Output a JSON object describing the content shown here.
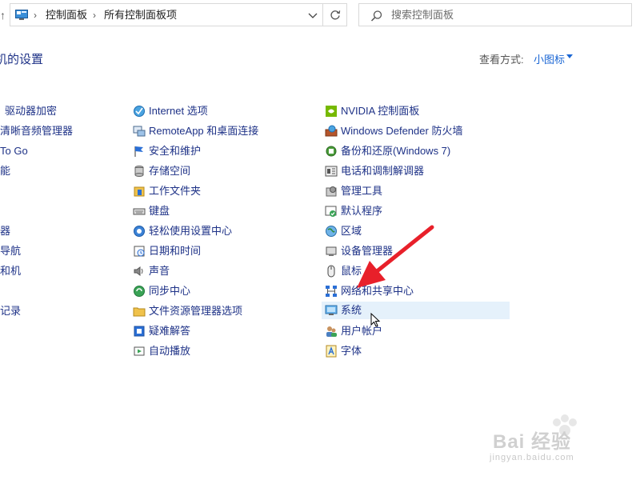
{
  "address_bar": {
    "breadcrumbs": [
      "控制面板",
      "所有控制面板项"
    ],
    "refresh_icon": "refresh-icon",
    "search_placeholder": "搜索控制面板"
  },
  "header": {
    "title": "机的设置",
    "view_by_label": "查看方式:",
    "view_by_value": "小图标"
  },
  "columns": [
    [
      {
        "label": "驱动器加密",
        "icon": "bitlocker-icon"
      },
      {
        "label": "清晰音频管理器",
        "icon": "audio-manager-icon"
      },
      {
        "label": " To Go",
        "icon": "usb-drive-icon"
      },
      {
        "label": "能",
        "icon": "power-icon"
      },
      {
        "label": "",
        "icon": ""
      },
      {
        "label": "器",
        "icon": "device-icon"
      },
      {
        "label": "导航",
        "icon": "navigation-icon"
      },
      {
        "label": "和机",
        "icon": "machine-icon"
      },
      {
        "label": "",
        "icon": ""
      },
      {
        "label": "记录",
        "icon": "history-icon"
      }
    ],
    [
      {
        "label": "Internet 选项",
        "icon": "internet-options-icon"
      },
      {
        "label": "RemoteApp 和桌面连接",
        "icon": "remoteapp-icon"
      },
      {
        "label": "安全和维护",
        "icon": "security-flag-icon"
      },
      {
        "label": "存储空间",
        "icon": "storage-icon"
      },
      {
        "label": "工作文件夹",
        "icon": "work-folders-icon"
      },
      {
        "label": "键盘",
        "icon": "keyboard-icon"
      },
      {
        "label": "轻松使用设置中心",
        "icon": "ease-of-access-icon"
      },
      {
        "label": "日期和时间",
        "icon": "datetime-icon"
      },
      {
        "label": "声音",
        "icon": "sound-icon"
      },
      {
        "label": "同步中心",
        "icon": "sync-center-icon"
      },
      {
        "label": "文件资源管理器选项",
        "icon": "folder-options-icon"
      },
      {
        "label": "疑难解答",
        "icon": "troubleshooting-icon"
      },
      {
        "label": "自动播放",
        "icon": "autoplay-icon"
      }
    ],
    [
      {
        "label": "NVIDIA 控制面板",
        "icon": "nvidia-icon"
      },
      {
        "label": "Windows Defender 防火墙",
        "icon": "firewall-icon"
      },
      {
        "label": "备份和还原(Windows 7)",
        "icon": "backup-restore-icon"
      },
      {
        "label": "电话和调制解调器",
        "icon": "phone-modem-icon"
      },
      {
        "label": "管理工具",
        "icon": "admin-tools-icon"
      },
      {
        "label": "默认程序",
        "icon": "default-programs-icon"
      },
      {
        "label": "区域",
        "icon": "region-icon"
      },
      {
        "label": "设备管理器",
        "icon": "device-manager-icon"
      },
      {
        "label": "鼠标",
        "icon": "mouse-icon"
      },
      {
        "label": "网络和共享中心",
        "icon": "network-sharing-icon"
      },
      {
        "label": "系统",
        "icon": "system-icon",
        "selected": true
      },
      {
        "label": "用户帐户",
        "icon": "user-accounts-icon"
      },
      {
        "label": "字体",
        "icon": "fonts-icon"
      }
    ]
  ],
  "watermark": {
    "brand": "Bai 经验",
    "url": "jingyan.baidu.com"
  },
  "colors": {
    "link": "#1e3287",
    "accent": "#1a66d4",
    "selection": "#e5f1fb",
    "arrow": "#e8202a"
  }
}
